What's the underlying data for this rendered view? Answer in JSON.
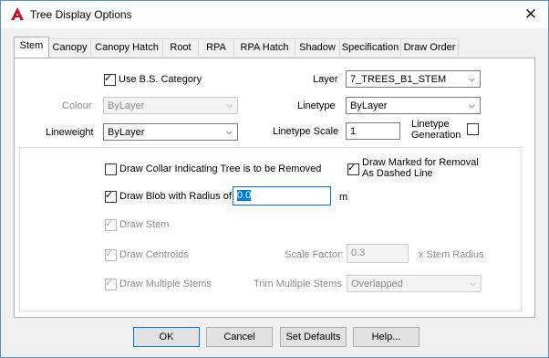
{
  "window": {
    "title": "Tree Display Options",
    "close_glyph": "✕",
    "app_icon": "autocad-logo-icon",
    "accent": "#0078d7"
  },
  "tabs": [
    {
      "label": "Stem",
      "active": true
    },
    {
      "label": "Canopy"
    },
    {
      "label": "Canopy Hatch"
    },
    {
      "label": "Root"
    },
    {
      "label": "RPA"
    },
    {
      "label": "RPA Hatch"
    },
    {
      "label": "Shadow"
    },
    {
      "label": "Specification"
    },
    {
      "label": "Draw Order"
    }
  ],
  "stem": {
    "use_bs_category": {
      "label": "Use B.S. Category",
      "checked": true
    },
    "colour": {
      "label": "Colour",
      "value": "ByLayer",
      "enabled": false
    },
    "lineweight": {
      "label": "Lineweight",
      "value": "ByLayer"
    },
    "layer": {
      "label": "Layer",
      "value": "7_TREES_B1_STEM"
    },
    "linetype": {
      "label": "Linetype",
      "value": "ByLayer"
    },
    "linetype_scale": {
      "label": "Linetype Scale",
      "value": "1"
    },
    "linetype_generation": {
      "label_line1": "Linetype",
      "label_line2": "Generation",
      "checked": false
    },
    "draw_collar": {
      "label": "Draw Collar Indicating Tree is to be Removed",
      "checked": false
    },
    "draw_marked": {
      "label_line1": "Draw Marked for Removal",
      "label_line2": "As Dashed Line",
      "checked": true
    },
    "draw_blob": {
      "label": "Draw Blob with Radius of",
      "checked": true,
      "value": "0.0",
      "unit": "m"
    },
    "draw_stem": {
      "label": "Draw Stem",
      "checked": true,
      "enabled": false
    },
    "draw_centroids": {
      "label": "Draw Centroids",
      "checked": true,
      "enabled": false
    },
    "scale_factor": {
      "label": "Scale Factor:",
      "value": "0.3",
      "suffix": "x Stem Radius"
    },
    "draw_multiple_stems": {
      "label": "Draw Multiple Stems",
      "checked": true,
      "enabled": false
    },
    "trim_multiple_stems": {
      "label": "Trim Multiple Stems",
      "value": "Overlapped"
    }
  },
  "buttons": {
    "ok": "OK",
    "cancel": "Cancel",
    "set_defaults": "Set Defaults",
    "help": "Help..."
  },
  "glyphs": {
    "check": "✓",
    "dropdown": "⌵"
  }
}
